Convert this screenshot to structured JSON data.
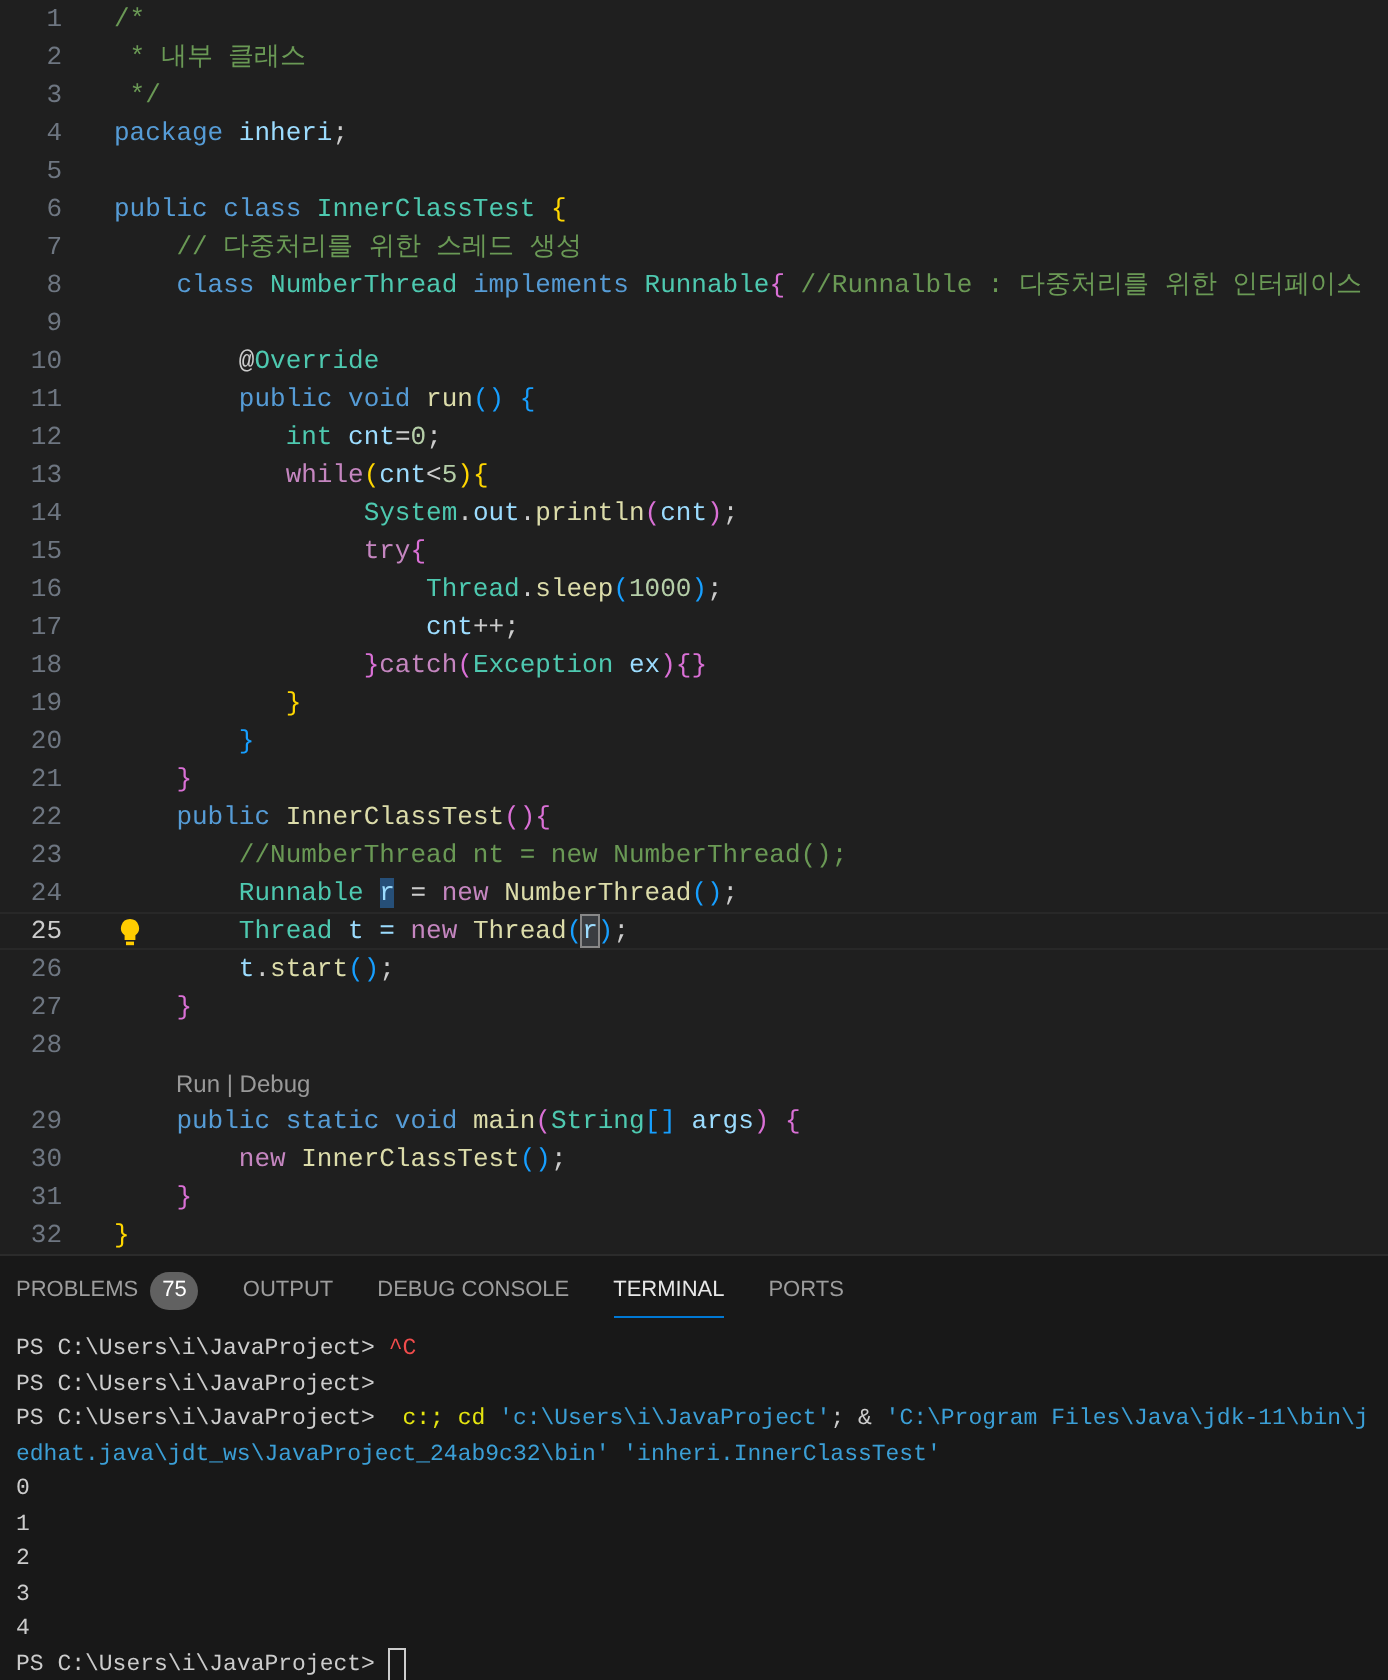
{
  "editor": {
    "lines": [
      {
        "kind": "code",
        "number": "1",
        "tokens": [
          {
            "t": "/*",
            "kind": "comment"
          }
        ]
      },
      {
        "kind": "code",
        "number": "2",
        "tokens": [
          {
            "t": " * 내부 클래스",
            "kind": "comment"
          }
        ]
      },
      {
        "kind": "code",
        "number": "3",
        "tokens": [
          {
            "t": " */",
            "kind": "comment"
          }
        ]
      },
      {
        "kind": "code",
        "number": "4",
        "tokens": [
          {
            "t": "package",
            "kind": "kw"
          },
          {
            "t": " inheri",
            "kind": "var"
          },
          {
            "t": ";",
            "kind": "plain"
          }
        ]
      },
      {
        "kind": "code",
        "number": "5"
      },
      {
        "kind": "code",
        "number": "6",
        "tokens": [
          {
            "t": "public class ",
            "kind": "kw"
          },
          {
            "t": "InnerClassTest ",
            "kind": "type"
          },
          {
            "t": "{",
            "kind": "b1"
          }
        ]
      },
      {
        "kind": "code",
        "number": "7",
        "tokens": [
          {
            "t": "    // 다중처리를 위한 스레드 생성",
            "kind": "comment"
          }
        ]
      },
      {
        "kind": "code",
        "number": "8",
        "tokens": [
          {
            "t": "    class ",
            "kind": "kw"
          },
          {
            "t": "NumberThread",
            "kind": "type"
          },
          {
            "t": " implements ",
            "kind": "kw"
          },
          {
            "t": "Runnable",
            "kind": "type"
          },
          {
            "t": "{",
            "kind": "b2"
          },
          {
            "t": " //Runnalble : 다중처리를 위한 인터페이스",
            "kind": "comment"
          }
        ]
      },
      {
        "kind": "code",
        "number": "9"
      },
      {
        "kind": "code",
        "number": "10",
        "tokens": [
          {
            "t": "        @",
            "kind": "plain"
          },
          {
            "t": "Override",
            "kind": "type"
          }
        ]
      },
      {
        "kind": "code",
        "number": "11",
        "tokens": [
          {
            "t": "        public void ",
            "kind": "kw"
          },
          {
            "t": "run",
            "kind": "fn"
          },
          {
            "t": "() {",
            "kind": "b3"
          }
        ]
      },
      {
        "kind": "code",
        "number": "12",
        "tokens": [
          {
            "t": "           int ",
            "kind": "type"
          },
          {
            "t": "cnt",
            "kind": "var"
          },
          {
            "t": "=",
            "kind": "plain"
          },
          {
            "t": "0",
            "kind": "num"
          },
          {
            "t": ";",
            "kind": "plain"
          }
        ]
      },
      {
        "kind": "code",
        "number": "13",
        "tokens": [
          {
            "t": "           while",
            "kind": "ctrl"
          },
          {
            "t": "(",
            "kind": "b1"
          },
          {
            "t": "cnt",
            "kind": "var"
          },
          {
            "t": "<",
            "kind": "plain"
          },
          {
            "t": "5",
            "kind": "num"
          },
          {
            "t": ")",
            "kind": "b1"
          },
          {
            "t": "{",
            "kind": "b1"
          }
        ]
      },
      {
        "kind": "code",
        "number": "14",
        "tokens": [
          {
            "t": "                System",
            "kind": "type"
          },
          {
            "t": ".",
            "kind": "plain"
          },
          {
            "t": "out",
            "kind": "var"
          },
          {
            "t": ".",
            "kind": "plain"
          },
          {
            "t": "println",
            "kind": "fn"
          },
          {
            "t": "(",
            "kind": "b2"
          },
          {
            "t": "cnt",
            "kind": "var"
          },
          {
            "t": ")",
            "kind": "b2"
          },
          {
            "t": ";",
            "kind": "plain"
          }
        ]
      },
      {
        "kind": "code",
        "number": "15",
        "tokens": [
          {
            "t": "                try",
            "kind": "ctrl"
          },
          {
            "t": "{",
            "kind": "b2"
          }
        ]
      },
      {
        "kind": "code",
        "number": "16",
        "tokens": [
          {
            "t": "                    Thread",
            "kind": "type"
          },
          {
            "t": ".",
            "kind": "plain"
          },
          {
            "t": "sleep",
            "kind": "fn"
          },
          {
            "t": "(",
            "kind": "b3"
          },
          {
            "t": "1000",
            "kind": "num"
          },
          {
            "t": ")",
            "kind": "b3"
          },
          {
            "t": ";",
            "kind": "plain"
          }
        ]
      },
      {
        "kind": "code",
        "number": "17",
        "tokens": [
          {
            "t": "                    cnt",
            "kind": "var"
          },
          {
            "t": "++;",
            "kind": "plain"
          }
        ]
      },
      {
        "kind": "code",
        "number": "18",
        "tokens": [
          {
            "t": "                }",
            "kind": "b2"
          },
          {
            "t": "catch",
            "kind": "ctrl"
          },
          {
            "t": "(",
            "kind": "b2"
          },
          {
            "t": "Exception ",
            "kind": "type"
          },
          {
            "t": "ex",
            "kind": "var"
          },
          {
            "t": ")",
            "kind": "b2"
          },
          {
            "t": "{}",
            "kind": "b2"
          }
        ]
      },
      {
        "kind": "code",
        "number": "19",
        "tokens": [
          {
            "t": "           }",
            "kind": "b1"
          }
        ]
      },
      {
        "kind": "code",
        "number": "20",
        "tokens": [
          {
            "t": "        }",
            "kind": "b3"
          }
        ]
      },
      {
        "kind": "code",
        "number": "21",
        "tokens": [
          {
            "t": "    }",
            "kind": "b2"
          }
        ]
      },
      {
        "kind": "code",
        "number": "22",
        "tokens": [
          {
            "t": "    public ",
            "kind": "kw"
          },
          {
            "t": "InnerClassTest",
            "kind": "fn"
          },
          {
            "t": "()",
            "kind": "b2"
          },
          {
            "t": "{",
            "kind": "b2"
          }
        ]
      },
      {
        "kind": "code",
        "number": "23",
        "tokens": [
          {
            "t": "        //NumberThread nt = new NumberThread();",
            "kind": "comment"
          }
        ]
      },
      {
        "kind": "code",
        "number": "24",
        "tokens": [
          {
            "t": "        Runnable ",
            "kind": "type"
          },
          {
            "t": "r",
            "kind": "var_match"
          },
          {
            "t": " = ",
            "kind": "plain"
          },
          {
            "t": "new ",
            "kind": "ctrl"
          },
          {
            "t": "NumberThread",
            "kind": "fn"
          },
          {
            "t": "()",
            "kind": "b3"
          },
          {
            "t": ";",
            "kind": "plain"
          }
        ]
      },
      {
        "kind": "code",
        "number": "25",
        "current": true,
        "tokens": [
          {
            "t": "        Thread",
            "kind": "type"
          },
          {
            "t": " t = ",
            "kind": "var"
          },
          {
            "t": "new ",
            "kind": "ctrl"
          },
          {
            "t": "Thread",
            "kind": "fn"
          },
          {
            "t": "(",
            "kind": "b3"
          },
          {
            "t": "r",
            "kind": "var_cursor"
          },
          {
            "t": ")",
            "kind": "b3"
          },
          {
            "t": ";",
            "kind": "plain"
          }
        ]
      },
      {
        "kind": "code",
        "number": "26",
        "tokens": [
          {
            "t": "        t",
            "kind": "var"
          },
          {
            "t": ".",
            "kind": "plain"
          },
          {
            "t": "start",
            "kind": "fn"
          },
          {
            "t": "()",
            "kind": "b3"
          },
          {
            "t": ";",
            "kind": "plain"
          }
        ]
      },
      {
        "kind": "code",
        "number": "27",
        "tokens": [
          {
            "t": "    }",
            "kind": "b2"
          }
        ]
      },
      {
        "kind": "code",
        "number": "28"
      },
      {
        "kind": "codelens",
        "text": "Run | Debug"
      },
      {
        "kind": "code",
        "number": "29",
        "tokens": [
          {
            "t": "    public static void ",
            "kind": "kw"
          },
          {
            "t": "main",
            "kind": "fn"
          },
          {
            "t": "(",
            "kind": "b2"
          },
          {
            "t": "String",
            "kind": "type"
          },
          {
            "t": "[] ",
            "kind": "b3"
          },
          {
            "t": "args",
            "kind": "var"
          },
          {
            "t": ") {",
            "kind": "b2"
          }
        ]
      },
      {
        "kind": "code",
        "number": "30",
        "tokens": [
          {
            "t": "        new ",
            "kind": "ctrl"
          },
          {
            "t": "InnerClassTest",
            "kind": "fn"
          },
          {
            "t": "()",
            "kind": "b3"
          },
          {
            "t": ";",
            "kind": "plain"
          }
        ]
      },
      {
        "kind": "code",
        "number": "31",
        "tokens": [
          {
            "t": "    }",
            "kind": "b2"
          }
        ]
      },
      {
        "kind": "code",
        "number": "32",
        "tokens": [
          {
            "t": "}",
            "kind": "b1"
          }
        ]
      }
    ]
  },
  "panel": {
    "tabs": [
      {
        "label": "PROBLEMS",
        "badge": "75",
        "selected": false
      },
      {
        "label": "OUTPUT",
        "selected": false
      },
      {
        "label": "DEBUG CONSOLE",
        "selected": false
      },
      {
        "label": "TERMINAL",
        "selected": true
      },
      {
        "label": "PORTS",
        "selected": false
      }
    ],
    "terminal": {
      "lines": [
        {
          "tokens": [
            {
              "t": "PS C:\\Users\\i\\JavaProject> ",
              "kind": "plain"
            },
            {
              "t": "^C",
              "kind": "red"
            }
          ]
        },
        {
          "tokens": [
            {
              "t": "PS C:\\Users\\i\\JavaProject>",
              "kind": "plain"
            }
          ]
        },
        {
          "tokens": [
            {
              "t": "PS C:\\Users\\i\\JavaProject>  ",
              "kind": "plain"
            },
            {
              "t": "c:; cd ",
              "kind": "yellow"
            },
            {
              "t": "'c:\\Users\\i\\JavaProject'",
              "kind": "string"
            },
            {
              "t": "; & ",
              "kind": "plain"
            },
            {
              "t": "'C:\\Program Files\\Java\\jdk-11\\bin\\j",
              "kind": "string"
            }
          ]
        },
        {
          "tokens": [
            {
              "t": "edhat.java\\jdt_ws\\JavaProject_24ab9c32\\bin' ",
              "kind": "string"
            },
            {
              "t": "'inheri.InnerClassTest'",
              "kind": "string"
            }
          ]
        },
        {
          "tokens": [
            {
              "t": "0",
              "kind": "plain"
            }
          ]
        },
        {
          "tokens": [
            {
              "t": "1",
              "kind": "plain"
            }
          ]
        },
        {
          "tokens": [
            {
              "t": "2",
              "kind": "plain"
            }
          ]
        },
        {
          "tokens": [
            {
              "t": "3",
              "kind": "plain"
            }
          ]
        },
        {
          "tokens": [
            {
              "t": "4",
              "kind": "plain"
            }
          ]
        },
        {
          "tokens": [
            {
              "t": "PS C:\\Users\\i\\JavaProject> ",
              "kind": "plain"
            }
          ],
          "cursor": true
        }
      ]
    }
  }
}
